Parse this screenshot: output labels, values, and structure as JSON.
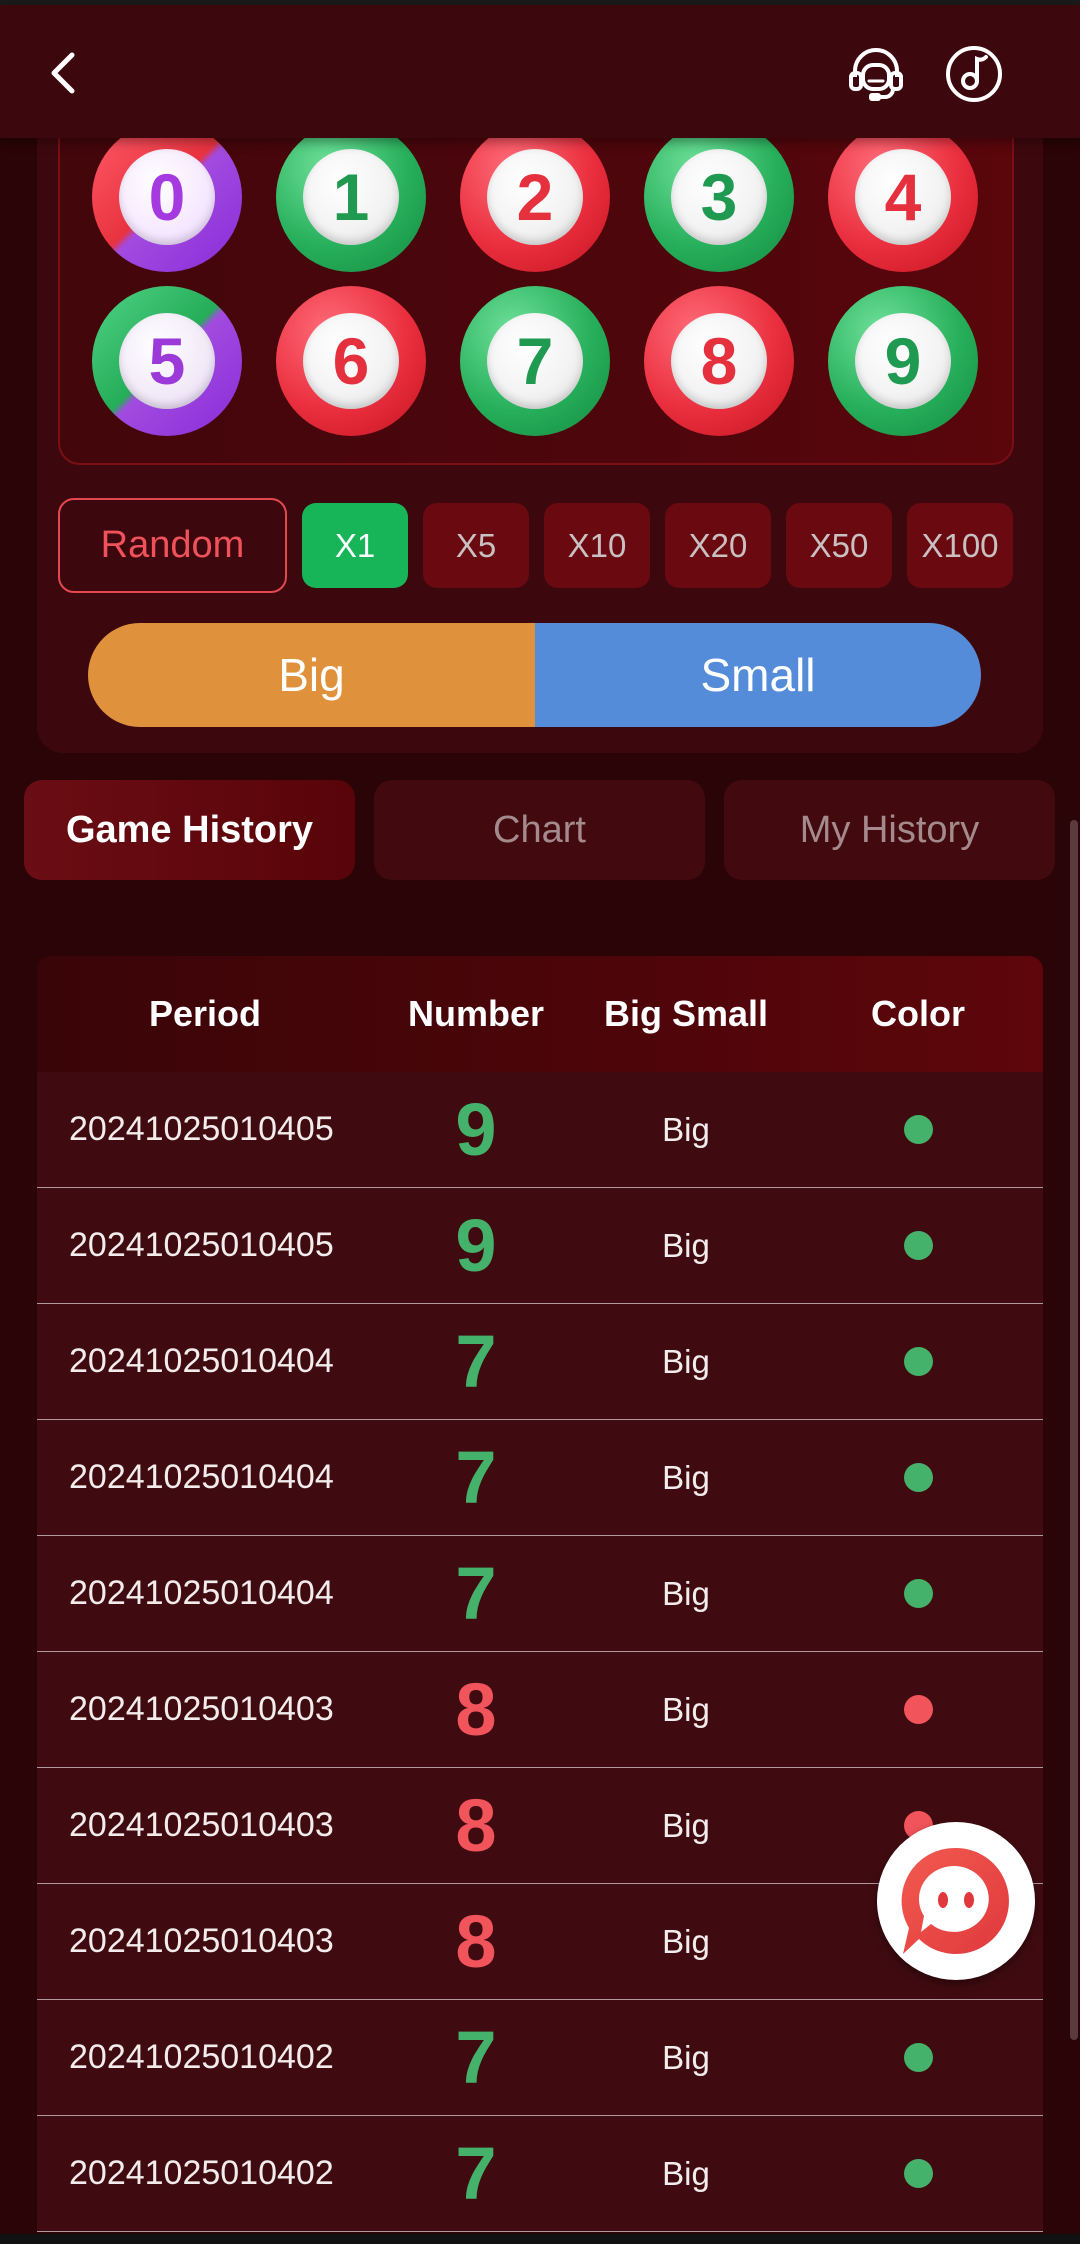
{
  "header": {
    "back_icon": "chevron-left-icon",
    "service_icon": "headset-icon",
    "music_icon": "music-note-icon"
  },
  "balls": [
    {
      "number": "0",
      "color": "red-violet"
    },
    {
      "number": "1",
      "color": "green"
    },
    {
      "number": "2",
      "color": "red"
    },
    {
      "number": "3",
      "color": "green"
    },
    {
      "number": "4",
      "color": "red"
    },
    {
      "number": "5",
      "color": "green-violet"
    },
    {
      "number": "6",
      "color": "red"
    },
    {
      "number": "7",
      "color": "green"
    },
    {
      "number": "8",
      "color": "red"
    },
    {
      "number": "9",
      "color": "green"
    }
  ],
  "betting": {
    "random_label": "Random",
    "multipliers": [
      "X1",
      "X5",
      "X10",
      "X20",
      "X50",
      "X100"
    ],
    "active_multiplier": "X1",
    "big_label": "Big",
    "small_label": "Small"
  },
  "tabs": [
    {
      "label": "Game History",
      "active": true
    },
    {
      "label": "Chart",
      "active": false
    },
    {
      "label": "My History",
      "active": false
    }
  ],
  "table": {
    "headers": {
      "period": "Period",
      "number": "Number",
      "big_small": "Big Small",
      "color": "Color"
    },
    "rows": [
      {
        "period": "20241025010405",
        "number": "9",
        "big_small": "Big",
        "color": "green"
      },
      {
        "period": "20241025010405",
        "number": "9",
        "big_small": "Big",
        "color": "green"
      },
      {
        "period": "20241025010404",
        "number": "7",
        "big_small": "Big",
        "color": "green"
      },
      {
        "period": "20241025010404",
        "number": "7",
        "big_small": "Big",
        "color": "green"
      },
      {
        "period": "20241025010404",
        "number": "7",
        "big_small": "Big",
        "color": "green"
      },
      {
        "period": "20241025010403",
        "number": "8",
        "big_small": "Big",
        "color": "red"
      },
      {
        "period": "20241025010403",
        "number": "8",
        "big_small": "Big",
        "color": "red"
      },
      {
        "period": "20241025010403",
        "number": "8",
        "big_small": "Big",
        "color": "red"
      },
      {
        "period": "20241025010402",
        "number": "7",
        "big_small": "Big",
        "color": "green"
      },
      {
        "period": "20241025010402",
        "number": "7",
        "big_small": "Big",
        "color": "green"
      }
    ]
  },
  "colors": {
    "green": "#45b26b",
    "red": "#f2545b",
    "accent": "#17b558"
  },
  "chat_icon": "chat-bubble-icon"
}
